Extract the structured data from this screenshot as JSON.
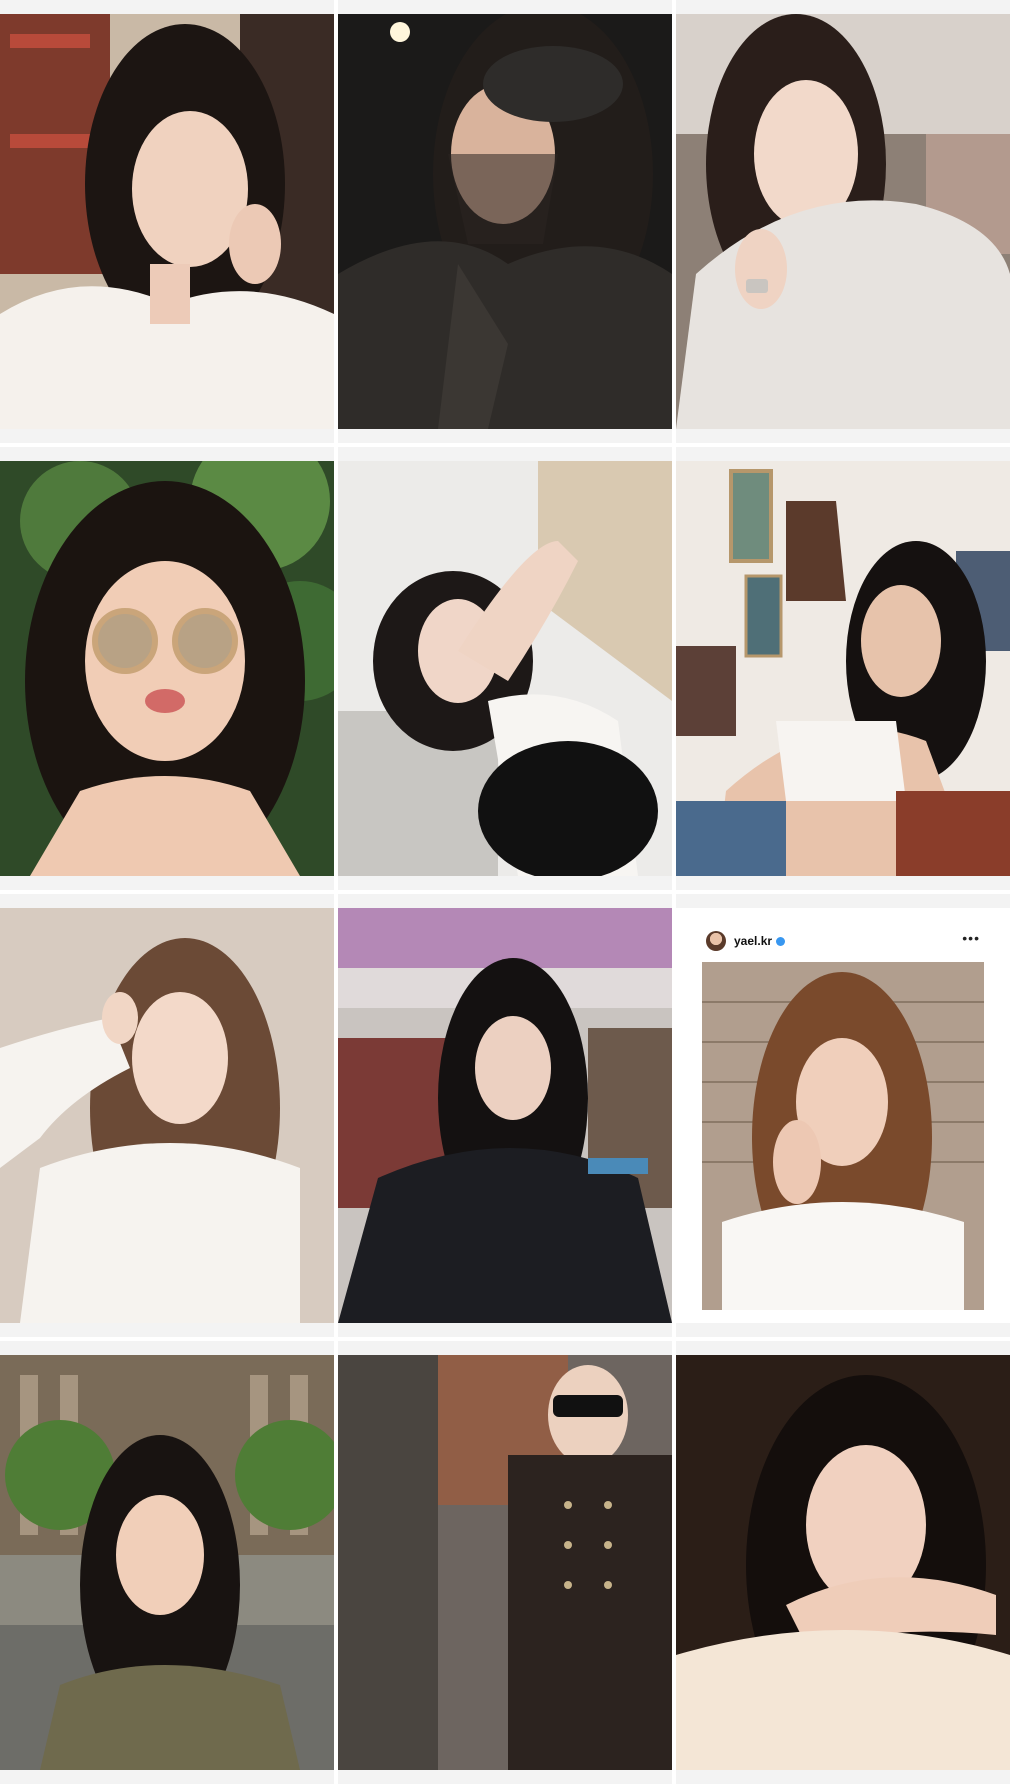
{
  "grid": {
    "posts": [
      {
        "subject": "selfie-white-blouse"
      },
      {
        "subject": "selfie-veiled-beret"
      },
      {
        "subject": "selfie-fur-coat"
      },
      {
        "subject": "selfie-round-sunglasses"
      },
      {
        "subject": "selfie-sofa-pose"
      },
      {
        "subject": "selfie-cafe-table"
      },
      {
        "subject": "selfie-white-top-hair-hold"
      },
      {
        "subject": "selfie-airplane-seat"
      },
      {
        "subject": "embedded-post",
        "username": "yael.kr",
        "more": "•••"
      },
      {
        "subject": "selfie-city-square"
      },
      {
        "subject": "selfie-sunglasses-knit-set"
      },
      {
        "subject": "selfie-hand-on-chin"
      }
    ]
  },
  "colors": {
    "verified": "#3897f0",
    "cell_background": "#f3f3f3"
  },
  "icons": {
    "verified": "verified-badge-icon",
    "more": "more-options-icon"
  }
}
